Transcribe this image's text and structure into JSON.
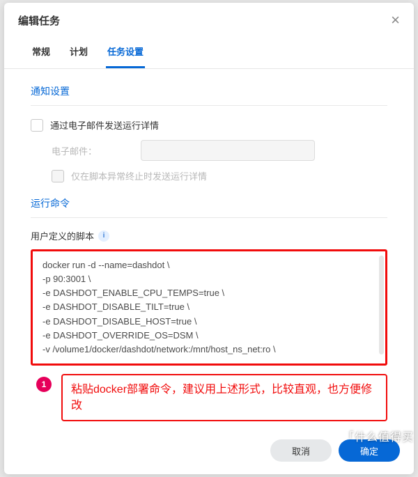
{
  "header": {
    "title": "编辑任务"
  },
  "tabs": {
    "general": "常规",
    "schedule": "计划",
    "settings": "任务设置"
  },
  "notify": {
    "title": "通知设置",
    "email_cb_label": "通过电子邮件发送运行详情",
    "email_label": "电子邮件：",
    "only_error_label": "仅在脚本异常终止时发送运行详情"
  },
  "run": {
    "title": "运行命令",
    "script_label": "用户定义的脚本",
    "script": "docker run -d --name=dashdot \\\n-p 90:3001 \\\n-e DASHDOT_ENABLE_CPU_TEMPS=true \\\n-e DASHDOT_DISABLE_TILT=true \\\n-e DASHDOT_DISABLE_HOST=true \\\n-e DASHDOT_OVERRIDE_OS=DSM \\\n-v /volume1/docker/dashdot/network:/mnt/host_ns_net:ro \\"
  },
  "callout": {
    "num": "1",
    "text": "粘贴docker部署命令，建议用上述形式，比较直观，也方便修改"
  },
  "footer": {
    "cancel": "取消",
    "ok": "确定"
  },
  "watermark": "「什么值得买"
}
